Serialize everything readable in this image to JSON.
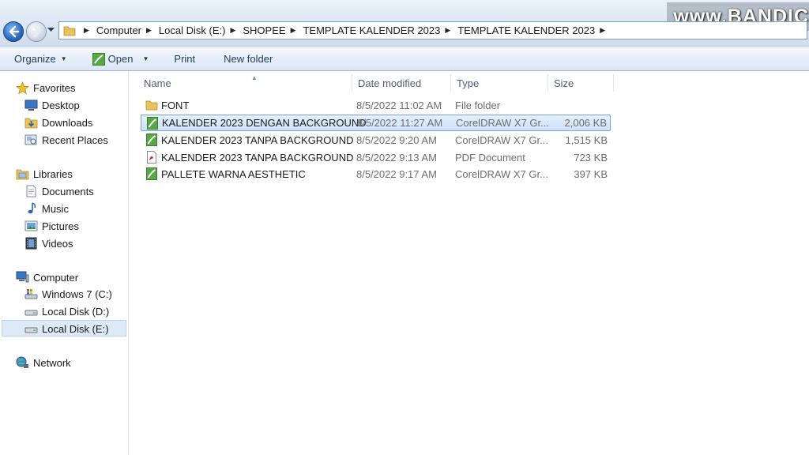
{
  "watermark": "www.BANDIC",
  "address": {
    "crumbs": [
      "Computer",
      "Local Disk (E:)",
      "SHOPEE",
      "TEMPLATE KALENDER 2023",
      "TEMPLATE KALENDER 2023"
    ]
  },
  "toolbar": {
    "organize": "Organize",
    "open": "Open",
    "print": "Print",
    "new_folder": "New folder"
  },
  "nav": {
    "favorites": "Favorites",
    "desktop": "Desktop",
    "downloads": "Downloads",
    "recent": "Recent Places",
    "libraries": "Libraries",
    "documents": "Documents",
    "music": "Music",
    "pictures": "Pictures",
    "videos": "Videos",
    "computer": "Computer",
    "drive_c": "Windows 7 (C:)",
    "drive_d": "Local Disk (D:)",
    "drive_e": "Local Disk (E:)",
    "network": "Network"
  },
  "columns": {
    "name": "Name",
    "date": "Date modified",
    "type": "Type",
    "size": "Size"
  },
  "files": [
    {
      "name": "FONT",
      "date": "8/5/2022 11:02 AM",
      "type": "File folder",
      "size": "",
      "icon": "folder-icon"
    },
    {
      "name": "KALENDER 2023 DENGAN BACKGROUND",
      "date": "8/5/2022 11:27 AM",
      "type": "CorelDRAW X7 Gr...",
      "size": "2,006 KB",
      "icon": "coreldraw-file-icon",
      "selected": true
    },
    {
      "name": "KALENDER 2023 TANPA BACKGROUND",
      "date": "8/5/2022 9:20 AM",
      "type": "CorelDRAW X7 Gr...",
      "size": "1,515 KB",
      "icon": "coreldraw-file-icon"
    },
    {
      "name": "KALENDER 2023 TANPA BACKGROUND",
      "date": "8/5/2022 9:13 AM",
      "type": "PDF Document",
      "size": "723 KB",
      "icon": "pdf-file-icon"
    },
    {
      "name": "PALLETE WARNA AESTHETIC",
      "date": "8/5/2022 9:17 AM",
      "type": "CorelDRAW X7 Gr...",
      "size": "397 KB",
      "icon": "coreldraw-file-icon"
    }
  ],
  "colors": {
    "selection": "#cfe2f8",
    "accent": "#1f5fb5"
  }
}
